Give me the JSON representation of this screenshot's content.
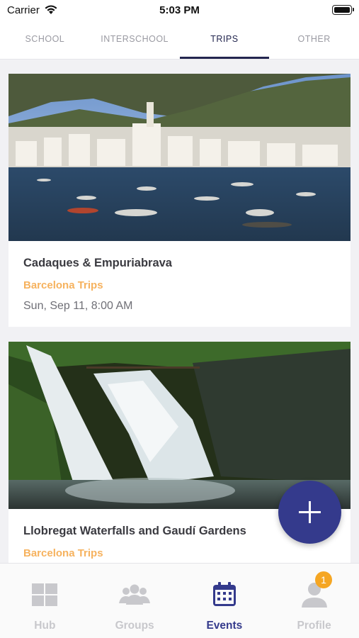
{
  "status_bar": {
    "carrier": "Carrier",
    "time": "5:03 PM"
  },
  "tabs": [
    {
      "label": "SCHOOL",
      "active": false
    },
    {
      "label": "INTERSCHOOL",
      "active": false
    },
    {
      "label": "TRIPS",
      "active": true
    },
    {
      "label": "OTHER",
      "active": false
    }
  ],
  "events": [
    {
      "title": "Cadaques & Empuriabrava",
      "category": "Barcelona Trips",
      "date": "Sun, Sep 11, 8:00 AM",
      "image": "coastal-town-photo"
    },
    {
      "title": "Llobregat Waterfalls and Gaudí Gardens",
      "category": "Barcelona Trips",
      "date": "",
      "image": "waterfall-photo"
    }
  ],
  "fab": {
    "icon": "plus-icon"
  },
  "bottom_nav": [
    {
      "label": "Hub",
      "icon": "grid-icon",
      "active": false
    },
    {
      "label": "Groups",
      "icon": "people-icon",
      "active": false
    },
    {
      "label": "Events",
      "icon": "calendar-icon",
      "active": true
    },
    {
      "label": "Profile",
      "icon": "person-icon",
      "active": false,
      "badge": "1"
    }
  ],
  "colors": {
    "primary": "#343a8c",
    "active_tab": "#23264f",
    "category": "#f6b25e",
    "badge": "#f5a623",
    "inactive": "#c8c8cc"
  }
}
